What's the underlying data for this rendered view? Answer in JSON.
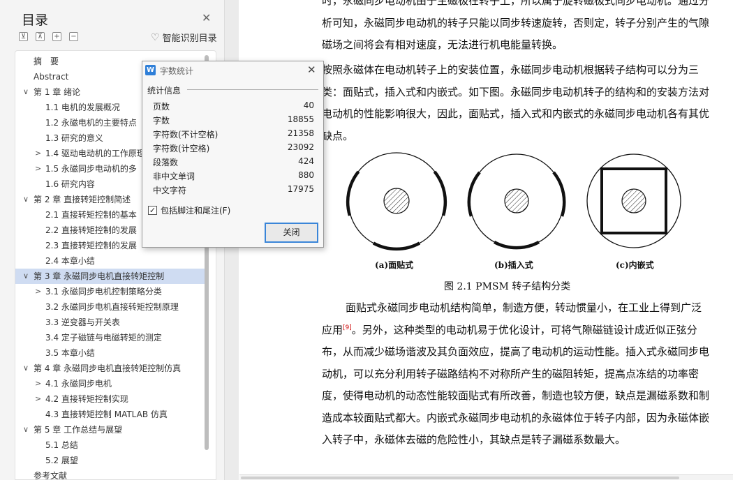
{
  "sidebar": {
    "title": "目录",
    "tool_buttons": [
      "⊻",
      "⊼",
      "+",
      "−"
    ],
    "smart_toc_label": "智能识别目录",
    "items": [
      {
        "label": "摘　要",
        "level": 0,
        "arrow": ""
      },
      {
        "label": "Abstract",
        "level": 0,
        "arrow": ""
      },
      {
        "label": "第 1 章  绪论",
        "level": 0,
        "arrow": "∨"
      },
      {
        "label": "1.1   电机的发展概况",
        "level": 1,
        "arrow": ""
      },
      {
        "label": "1.2   永磁电机的主要特点",
        "level": 1,
        "arrow": ""
      },
      {
        "label": "1.3   研究的意义",
        "level": 1,
        "arrow": ""
      },
      {
        "label": "1.4   驱动电动机的工作原理",
        "level": 1,
        "arrow": ">"
      },
      {
        "label": "1.5   永磁同步电动机的多",
        "level": 1,
        "arrow": ">"
      },
      {
        "label": "1.6   研究内容",
        "level": 1,
        "arrow": ""
      },
      {
        "label": "第 2 章   直接转矩控制简述",
        "level": 0,
        "arrow": "∨"
      },
      {
        "label": "2.1   直接转矩控制的基本",
        "level": 1,
        "arrow": ""
      },
      {
        "label": "2.2   直接转矩控制的发展",
        "level": 1,
        "arrow": ""
      },
      {
        "label": "2.3   直接转矩控制的发展",
        "level": 1,
        "arrow": ""
      },
      {
        "label": "2.4   本章小结",
        "level": 1,
        "arrow": ""
      },
      {
        "label": "第 3 章   永磁同步电机直接转矩控制",
        "level": 0,
        "arrow": "∨",
        "active": true
      },
      {
        "label": "3.1   永磁同步电机控制策略分类",
        "level": 1,
        "arrow": ">"
      },
      {
        "label": "3.2   永磁同步电机直接转矩控制原理",
        "level": 1,
        "arrow": ""
      },
      {
        "label": "3.3   逆变器与开关表",
        "level": 1,
        "arrow": ""
      },
      {
        "label": "3.4   定子磁链与电磁转矩的测定",
        "level": 1,
        "arrow": ""
      },
      {
        "label": "3.5   本章小结",
        "level": 1,
        "arrow": ""
      },
      {
        "label": "第 4 章  永磁同步电机直接转矩控制仿真",
        "level": 0,
        "arrow": "∨"
      },
      {
        "label": "4.1   永磁同步电机",
        "level": 1,
        "arrow": ">"
      },
      {
        "label": "4.2   直接转矩控制实现",
        "level": 1,
        "arrow": ">"
      },
      {
        "label": "4.3   直接转矩控制 MATLAB 仿真",
        "level": 1,
        "arrow": ""
      },
      {
        "label": "第 5 章  工作总结与展望",
        "level": 0,
        "arrow": "∨"
      },
      {
        "label": "5.1   总结",
        "level": 1,
        "arrow": ""
      },
      {
        "label": "5.2   展望",
        "level": 1,
        "arrow": ""
      },
      {
        "label": "参考文献",
        "level": 0,
        "arrow": ""
      }
    ]
  },
  "document": {
    "para1": "时，永磁同步电动机由于主磁极在转子上，所以属于旋转磁极式同步电动机。通过分析可知，永磁同步电动机的转子只能以同步转速旋转，否则定，转子分别产生的气隙磁场之间将会有相对速度，无法进行机电能量转换。",
    "para2": "按照永磁体在电动机转子上的安装位置，永磁同步电动机根据转子结构可以分为三类：面贴式，插入式和内嵌式。如下图。永磁同步电动机转子的结构和的安装方法对电动机的性能影响很大，因此，面贴式，插入式和内嵌式的永磁同步电动机各有其优缺点。",
    "figure_labels": [
      "(a)面贴式",
      "(b)插入式",
      "(c)内嵌式"
    ],
    "figure_caption": "图 2.1    PMSM 转子结构分类",
    "para3_before": "面贴式永磁同步电动机结构简单，制造方便，转动惯量小，在工业上得到广泛应用",
    "para3_cite": "[9]",
    "para3_after": "。另外，这种类型的电动机易于优化设计，可将气隙磁链设计成近似正弦分布，从而减少磁场谐波及其负面效应，提高了电动机的运动性能。插入式永磁同步电动机，可以充分利用转子磁路结构不对称所产生的磁阻转矩，提高点冻结的功率密度，使得电动机的动态性能较面贴式有所改善，制造也较方便，缺点是漏磁系数和制造成本较面贴式都大。内嵌式永磁同步电动机的永磁体位于转子内部，因为永磁体嵌入转子中，永磁体去磁的危险性小，其缺点是转子漏磁系数最大。"
  },
  "dialog": {
    "title": "字数统计",
    "icon_letter": "W",
    "section_label": "统计信息",
    "stats": [
      {
        "label": "页数",
        "value": "40"
      },
      {
        "label": "字数",
        "value": "18855"
      },
      {
        "label": "字符数(不计空格)",
        "value": "21358"
      },
      {
        "label": "字符数(计空格)",
        "value": "23092"
      },
      {
        "label": "段落数",
        "value": "424"
      },
      {
        "label": "非中文单词",
        "value": "880"
      },
      {
        "label": "中文字符",
        "value": "17975"
      }
    ],
    "checkbox_label": "包括脚注和尾注(F)",
    "checkbox_checked": true,
    "close_button": "关闭"
  },
  "colors": {
    "active_toc_bg": "#cfdcf2",
    "dialog_accent": "#3a85d8",
    "citation": "#cc0000"
  }
}
